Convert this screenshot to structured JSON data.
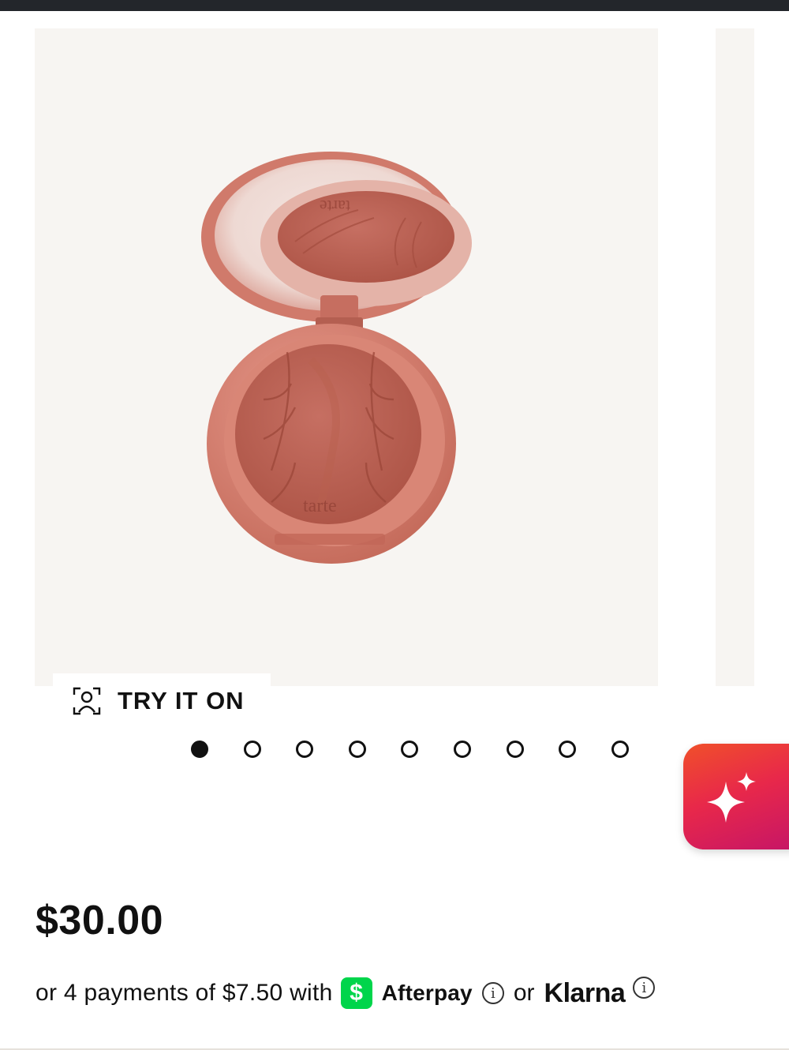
{
  "product": {
    "image_alt": "tarte blush compact",
    "brand_embossed": "tarte",
    "price": "$30.00"
  },
  "try_on": {
    "label": "TRY IT ON",
    "icon": "face-scan-icon"
  },
  "carousel": {
    "total_slides": 9,
    "active_index": 0
  },
  "ai_button": {
    "icon": "sparkle-icon"
  },
  "payments": {
    "prefix": "or 4 payments of $7.50 with",
    "cash_symbol": "$",
    "afterpay": "Afterpay",
    "info_glyph": "i",
    "or": "or",
    "klarna": "Klarna"
  },
  "colors": {
    "topbar": "#23262b",
    "image_bg": "#f7f5f2",
    "blush": "#c86a5c",
    "afterpay_green": "#00d54b",
    "ai_gradient_start": "#f0502a",
    "ai_gradient_end": "#c41468"
  }
}
